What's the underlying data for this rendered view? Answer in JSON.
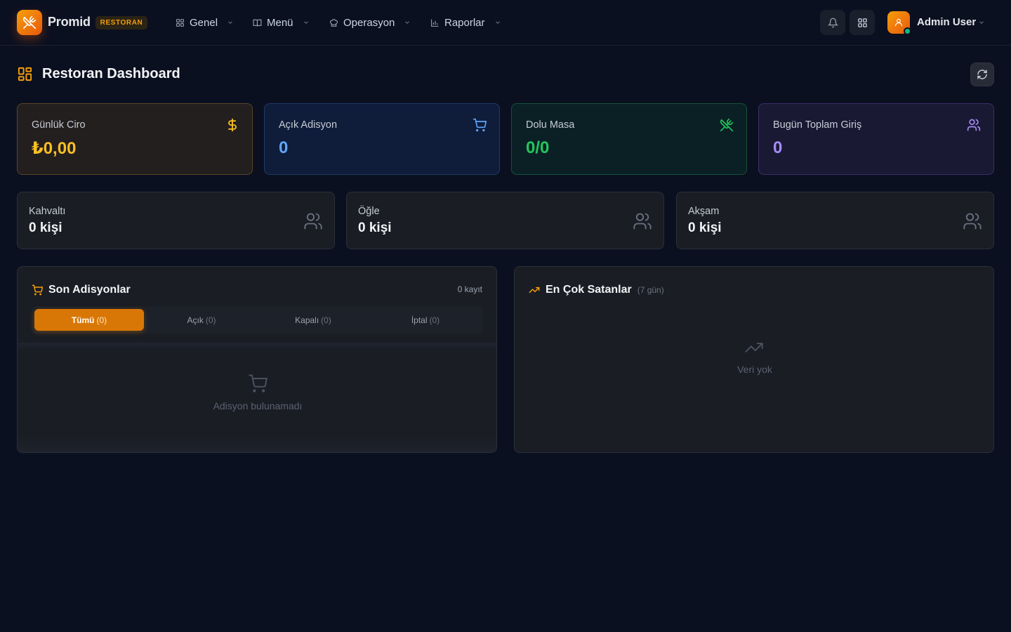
{
  "brand": {
    "name": "Promid",
    "badge": "RESTORAN"
  },
  "nav": [
    {
      "label": "Genel",
      "icon": "grid-icon"
    },
    {
      "label": "Menü",
      "icon": "book-icon"
    },
    {
      "label": "Operasyon",
      "icon": "chef-hat-icon"
    },
    {
      "label": "Raporlar",
      "icon": "bar-chart-icon"
    }
  ],
  "user": {
    "name": "Admin User",
    "status": "online"
  },
  "page": {
    "title": "Restoran Dashboard"
  },
  "stats": {
    "ciro": {
      "label": "Günlük Ciro",
      "value": "₺0,00",
      "color": "#fbbf24",
      "icon": "dollar-icon"
    },
    "adisyon": {
      "label": "Açık Adisyon",
      "value": "0",
      "color": "#60a5fa",
      "icon": "cart-icon"
    },
    "masa": {
      "label": "Dolu Masa",
      "value": "0/0",
      "color": "#22c55e",
      "icon": "utensils-crossed-icon"
    },
    "giris": {
      "label": "Bugün Toplam Giriş",
      "value": "0",
      "color": "#a78bfa",
      "icon": "users-icon"
    }
  },
  "meals": [
    {
      "label": "Kahvaltı",
      "value": "0 kişi"
    },
    {
      "label": "Öğle",
      "value": "0 kişi"
    },
    {
      "label": "Akşam",
      "value": "0 kişi"
    }
  ],
  "orders": {
    "title": "Son Adisyonlar",
    "meta": "0 kayıt",
    "tabs": [
      {
        "label": "Tümü",
        "count": "(0)",
        "active": true
      },
      {
        "label": "Açık",
        "count": "(0)",
        "active": false
      },
      {
        "label": "Kapalı",
        "count": "(0)",
        "active": false
      },
      {
        "label": "İptal",
        "count": "(0)",
        "active": false
      }
    ],
    "empty": "Adisyon bulunamadı"
  },
  "top_sellers": {
    "title": "En Çok Satanlar",
    "sub": "(7 gün)",
    "empty": "Veri yok"
  },
  "colors": {
    "accent": "#f59e0b",
    "accent_dark": "#d97706",
    "background": "#0b1020"
  }
}
